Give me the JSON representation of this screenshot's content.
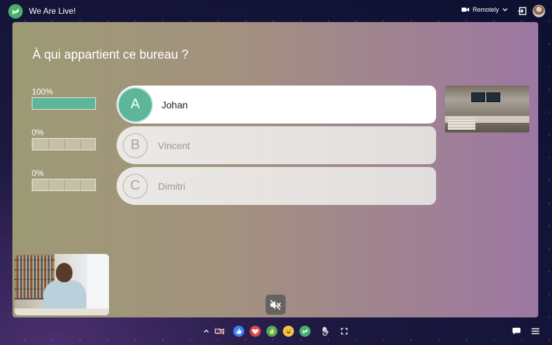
{
  "app": {
    "title": "We Are Live!"
  },
  "header": {
    "mode_label": "Remotely"
  },
  "quiz": {
    "question": "À qui appartient ce bureau ?",
    "results": [
      {
        "percent_label": "100%",
        "fraction": 1.0
      },
      {
        "percent_label": "0%",
        "fraction": 0.0
      },
      {
        "percent_label": "0%",
        "fraction": 0.0
      }
    ],
    "answers": [
      {
        "letter": "A",
        "text": "Johan",
        "correct": true
      },
      {
        "letter": "B",
        "text": "Vincent",
        "correct": false
      },
      {
        "letter": "C",
        "text": "Dimitri",
        "correct": false
      }
    ]
  },
  "colors": {
    "accent": "#5db59a",
    "brand": "#46b06a"
  },
  "icons": {
    "logo": "we-are-live-logo",
    "camera": "video-camera-icon",
    "exit": "exit-icon",
    "mute": "speaker-muted-icon",
    "toolbar": [
      "chevron-up-icon",
      "video-off-icon",
      "thumbs-up-icon",
      "heart-icon",
      "clap-icon",
      "laugh-icon",
      "logo-reaction-icon",
      "raise-hand-icon",
      "fullscreen-icon",
      "chat-icon",
      "menu-icon"
    ]
  }
}
